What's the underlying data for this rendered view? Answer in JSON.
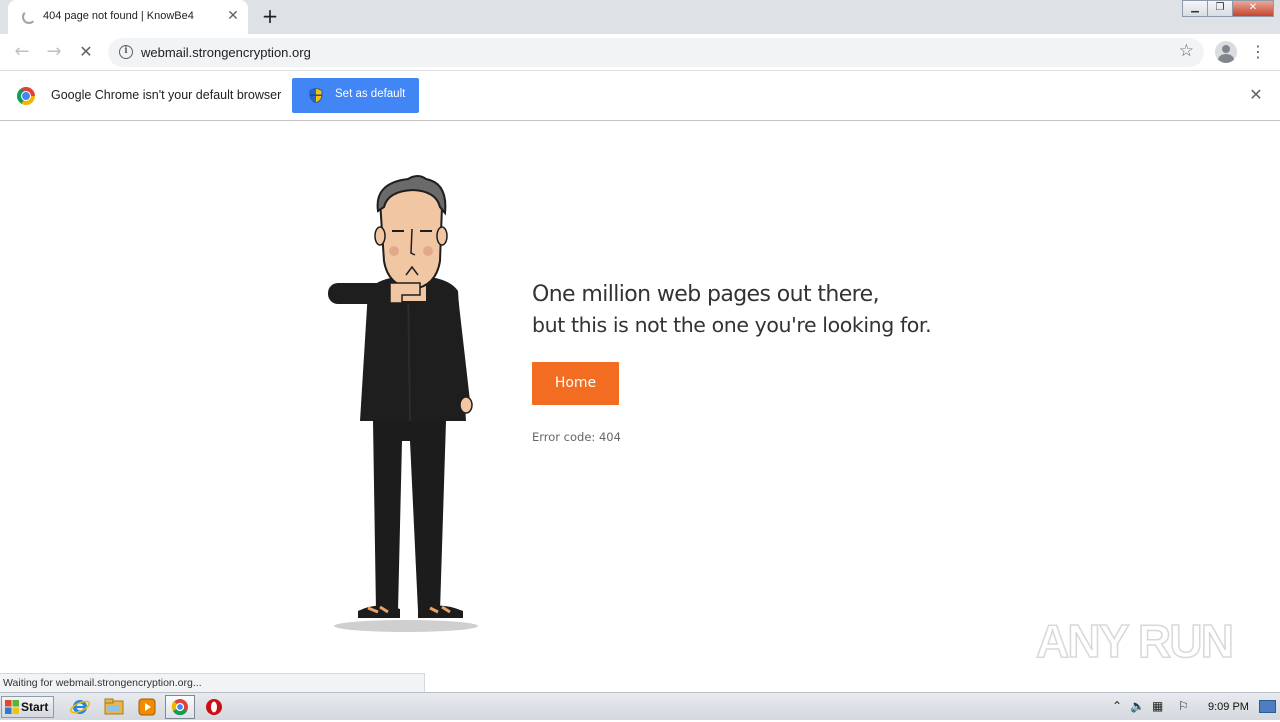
{
  "browser": {
    "tab": {
      "title": "404 page not found | KnowBe4"
    },
    "url": "webmail.strongencryption.org",
    "infobar": {
      "message": "Google Chrome isn't your default browser",
      "button_label": "Set as default"
    },
    "status_text": "Waiting for webmail.strongencryption.org..."
  },
  "page": {
    "headline": "One million web pages out there,",
    "subline": "but this is not the one you're looking for.",
    "home_label": "Home",
    "error_code": "Error code: 404",
    "accent_color": "#f26c22"
  },
  "watermark": {
    "text": "ANY RUN"
  },
  "taskbar": {
    "start_label": "Start",
    "clock": "9:09 PM"
  }
}
